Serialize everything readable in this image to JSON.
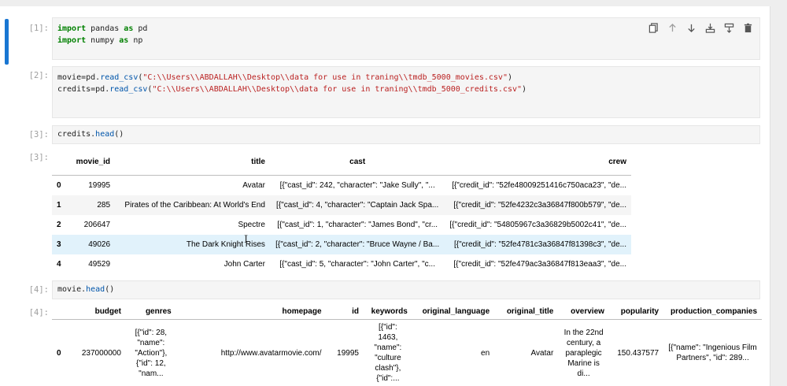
{
  "cells": [
    {
      "prompt": "[1]:",
      "lines": [
        [
          {
            "t": "kw",
            "v": "import"
          },
          {
            "t": "var",
            "v": " pandas "
          },
          {
            "t": "kw",
            "v": "as"
          },
          {
            "t": "var",
            "v": " pd"
          }
        ],
        [
          {
            "t": "kw",
            "v": "import"
          },
          {
            "t": "var",
            "v": " numpy "
          },
          {
            "t": "kw",
            "v": "as"
          },
          {
            "t": "var",
            "v": " np"
          }
        ]
      ]
    },
    {
      "prompt": "[2]:",
      "lines": [
        [
          {
            "t": "var",
            "v": "movie=pd."
          },
          {
            "t": "fn",
            "v": "read_csv"
          },
          {
            "t": "var",
            "v": "("
          },
          {
            "t": "str",
            "v": "\"C:\\\\Users\\\\ABDALLAH\\\\Desktop\\\\data for use in traning\\\\tmdb_5000_movies.csv\""
          },
          {
            "t": "var",
            "v": ")"
          }
        ],
        [
          {
            "t": "var",
            "v": "credits=pd."
          },
          {
            "t": "fn",
            "v": "read_csv"
          },
          {
            "t": "var",
            "v": "("
          },
          {
            "t": "str",
            "v": "\"C:\\\\Users\\\\ABDALLAH\\\\Desktop\\\\data for use in traning\\\\tmdb_5000_credits.csv\""
          },
          {
            "t": "var",
            "v": ")"
          }
        ]
      ]
    },
    {
      "prompt": "[3]:",
      "lines": [
        [
          {
            "t": "var",
            "v": "credits."
          },
          {
            "t": "fn",
            "v": "head"
          },
          {
            "t": "var",
            "v": "()"
          }
        ]
      ]
    },
    {
      "prompt": "[4]:",
      "lines": [
        [
          {
            "t": "var",
            "v": "movie."
          },
          {
            "t": "fn",
            "v": "head"
          },
          {
            "t": "var",
            "v": "()"
          }
        ]
      ]
    }
  ],
  "outputs": {
    "out3_prompt": "[3]:",
    "out4_prompt": "[4]:"
  },
  "credits_table": {
    "columns": [
      "",
      "movie_id",
      "title",
      "cast",
      "crew"
    ],
    "rows": [
      [
        "0",
        "19995",
        "Avatar",
        "[{\"cast_id\": 242, \"character\": \"Jake Sully\", \"...",
        "[{\"credit_id\": \"52fe48009251416c750aca23\", \"de..."
      ],
      [
        "1",
        "285",
        "Pirates of the Caribbean: At World's End",
        "[{\"cast_id\": 4, \"character\": \"Captain Jack Spa...",
        "[{\"credit_id\": \"52fe4232c3a36847f800b579\", \"de..."
      ],
      [
        "2",
        "206647",
        "Spectre",
        "[{\"cast_id\": 1, \"character\": \"James Bond\", \"cr...",
        "[{\"credit_id\": \"54805967c3a36829b5002c41\", \"de..."
      ],
      [
        "3",
        "49026",
        "The Dark Knight Rises",
        "[{\"cast_id\": 2, \"character\": \"Bruce Wayne / Ba...",
        "[{\"credit_id\": \"52fe4781c3a36847f81398c3\", \"de..."
      ],
      [
        "4",
        "49529",
        "John Carter",
        "[{\"cast_id\": 5, \"character\": \"John Carter\", \"c...",
        "[{\"credit_id\": \"52fe479ac3a36847f813eaa3\", \"de..."
      ]
    ]
  },
  "movie_table": {
    "columns": [
      "",
      "budget",
      "genres",
      "homepage",
      "id",
      "keywords",
      "original_language",
      "original_title",
      "overview",
      "popularity",
      "production_companies"
    ],
    "rows": [
      [
        "0",
        "237000000",
        "[{\"id\": 28, \"name\": \"Action\"}, {\"id\": 12, \"nam...",
        "http://www.avatarmovie.com/",
        "19995",
        "[{\"id\": 1463, \"name\": \"culture clash\"}, {\"id\":...",
        "en",
        "Avatar",
        "In the 22nd century, a paraplegic Marine is di...",
        "150.437577",
        "[{\"name\": \"Ingenious Film Partners\", \"id\": 289..."
      ]
    ]
  },
  "toolbar": {
    "icons": [
      "copy-icon",
      "arrow-up-icon",
      "arrow-down-icon",
      "insert-above-icon",
      "insert-below-icon",
      "delete-icon"
    ]
  }
}
